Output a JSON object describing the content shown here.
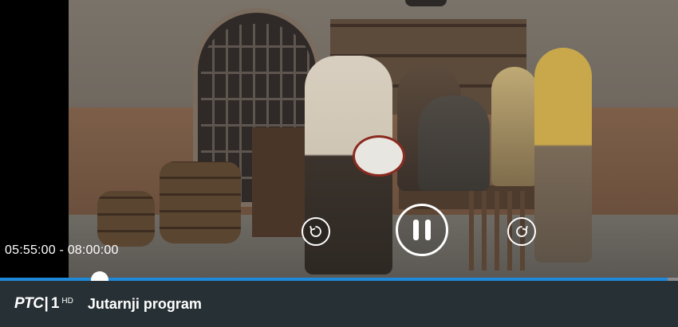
{
  "player": {
    "time_range": "05:55:00 - 08:00:00",
    "progress_fraction": 0.147,
    "buffer_end_fraction": 0.985,
    "accent_color": "#1e88d9"
  },
  "controls": {
    "rewind_icon": "rewind-icon",
    "pause_icon": "pause-icon",
    "forward_icon": "forward-icon"
  },
  "channel": {
    "logo_text": "PTC",
    "logo_separator": "|",
    "logo_number": "1",
    "logo_hd": "HD",
    "program_title": "Jutarnji program"
  }
}
